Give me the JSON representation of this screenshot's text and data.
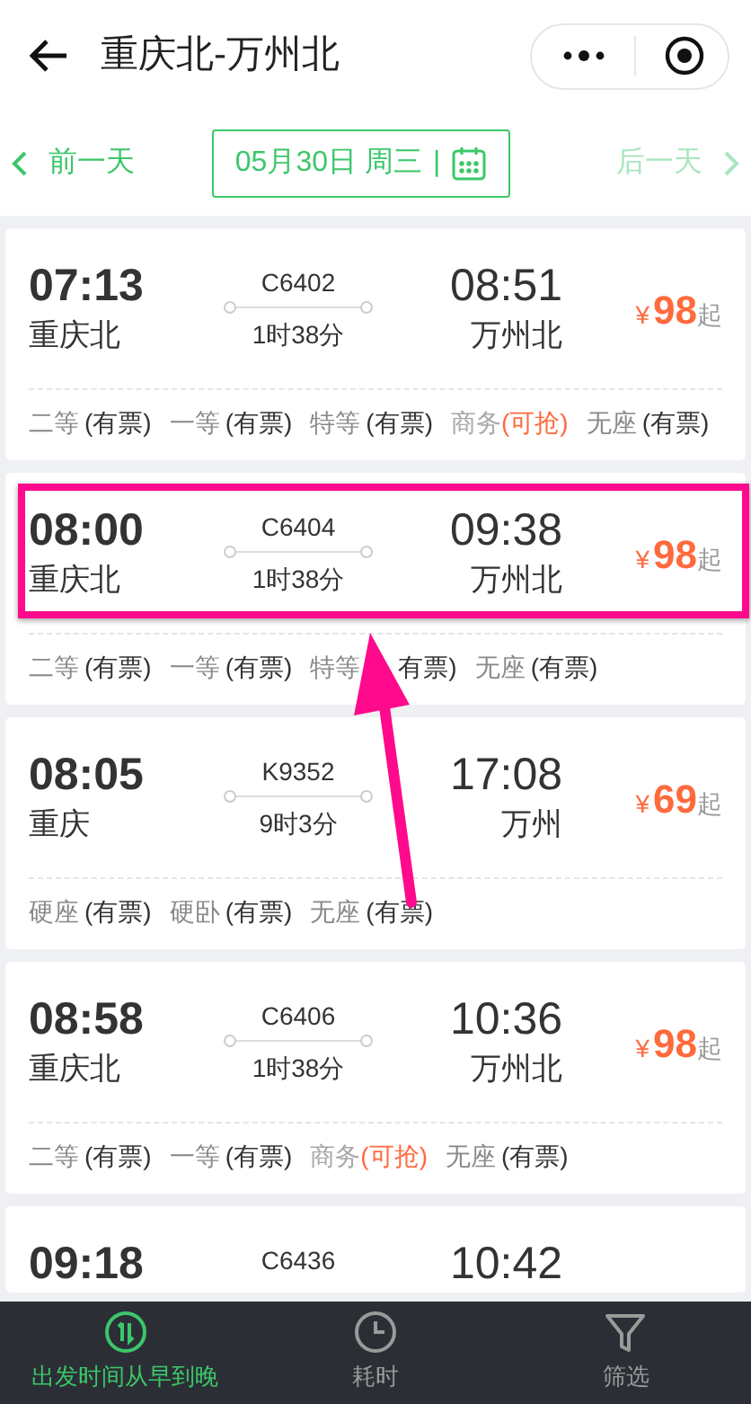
{
  "header": {
    "title": "重庆北-万州北"
  },
  "date_bar": {
    "prev_day": {
      "label": "前一天",
      "disabled": false
    },
    "date": "05月30日 周三",
    "separator": "|",
    "next_day": {
      "label": "后一天",
      "disabled": true
    }
  },
  "trains": [
    {
      "depart_time": "07:13",
      "depart_station": "重庆北",
      "train_no": "C6402",
      "duration": "1时38分",
      "arrive_time": "08:51",
      "arrive_station": "万州北",
      "currency": "¥",
      "price": "98",
      "price_suffix": "起",
      "highlighted": false,
      "seats": [
        {
          "name": "二等",
          "status": "(有票)",
          "kind": "available"
        },
        {
          "name": "一等",
          "status": "(有票)",
          "kind": "available"
        },
        {
          "name": "特等",
          "status": "(有票)",
          "kind": "available"
        },
        {
          "name": "商务",
          "status": "(可抢)",
          "kind": "grab"
        },
        {
          "name": "无座",
          "status": "(有票)",
          "kind": "available"
        }
      ]
    },
    {
      "depart_time": "08:00",
      "depart_station": "重庆北",
      "train_no": "C6404",
      "duration": "1时38分",
      "arrive_time": "09:38",
      "arrive_station": "万州北",
      "currency": "¥",
      "price": "98",
      "price_suffix": "起",
      "highlighted": true,
      "seats": [
        {
          "name": "二等",
          "status": "(有票)",
          "kind": "available"
        },
        {
          "name": "一等",
          "status": "(有票)",
          "kind": "available"
        },
        {
          "name": "特等",
          "status": "有票)",
          "kind": "covered"
        },
        {
          "name": "无座",
          "status": "(有票)",
          "kind": "available"
        }
      ]
    },
    {
      "depart_time": "08:05",
      "depart_station": "重庆",
      "train_no": "K9352",
      "duration": "9时3分",
      "arrive_time": "17:08",
      "arrive_station": "万州",
      "currency": "¥",
      "price": "69",
      "price_suffix": "起",
      "highlighted": false,
      "seats": [
        {
          "name": "硬座",
          "status": "(有票)",
          "kind": "available"
        },
        {
          "name": "硬卧",
          "status": "(有票)",
          "kind": "available"
        },
        {
          "name": "无座",
          "status": "(有票)",
          "kind": "available"
        }
      ]
    },
    {
      "depart_time": "08:58",
      "depart_station": "重庆北",
      "train_no": "C6406",
      "duration": "1时38分",
      "arrive_time": "10:36",
      "arrive_station": "万州北",
      "currency": "¥",
      "price": "98",
      "price_suffix": "起",
      "highlighted": false,
      "seats": [
        {
          "name": "二等",
          "status": "(有票)",
          "kind": "available"
        },
        {
          "name": "一等",
          "status": "(有票)",
          "kind": "available"
        },
        {
          "name": "商务",
          "status": "(可抢)",
          "kind": "grab"
        },
        {
          "name": "无座",
          "status": "(有票)",
          "kind": "available"
        }
      ]
    },
    {
      "depart_time": "09:18",
      "train_no": "C6436",
      "arrive_time": "10:42",
      "highlighted": false
    }
  ],
  "bottom_bar": [
    {
      "label": "出发时间从早到晚",
      "kind": "sort",
      "selected": true
    },
    {
      "label": "耗时",
      "kind": "clock",
      "selected": false
    },
    {
      "label": "筛选",
      "kind": "filter",
      "selected": false
    }
  ]
}
